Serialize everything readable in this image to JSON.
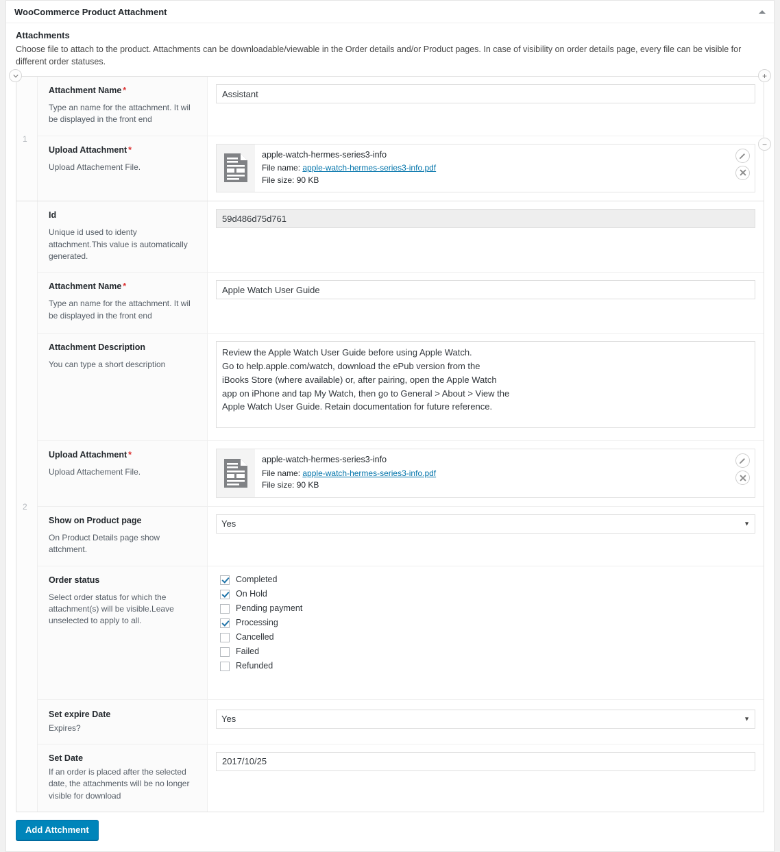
{
  "panel": {
    "title": "WooCommerce Product Attachment",
    "toggle_icon": "triangle-up-icon"
  },
  "intro": {
    "heading": "Attachments",
    "description": "Choose file to attach to the product. Attachments can be downloadable/viewable in the Order details and/or Product pages. In case of visibility on order details page, every file can be visible for different order statuses."
  },
  "repeater_controls": {
    "collapse_icon": "chevron-down-icon",
    "add_label": "+",
    "remove_label": "−"
  },
  "labels": {
    "attachment_name": "Attachment Name",
    "attachment_name_desc": "Type an name for the attachment. It wil be displayed in the front end",
    "upload_attachment": "Upload Attachment",
    "upload_attachment_desc": "Upload Attachement File.",
    "id": "Id",
    "id_desc": "Unique id used to identy attachment.This value is automatically generated.",
    "attachment_description": "Attachment Description",
    "attachment_description_desc": "You can type a short description",
    "show_on_product_page": "Show on Product page",
    "show_on_product_page_desc": "On Product Details page show attchment.",
    "order_status": "Order status",
    "order_status_desc": "Select order status for which the attachment(s) will be visible.Leave unselected to apply to all.",
    "set_expire_date": "Set expire Date",
    "set_expire_date_desc": "Expires?",
    "set_date": "Set Date",
    "set_date_desc": "If an order is placed after the selected date, the attachments will be no longer visible for download",
    "required_marker": "*"
  },
  "file_labels": {
    "file_name_prefix": "File name:",
    "file_size_prefix": "File size:",
    "edit_icon": "pencil-icon",
    "delete_icon": "close-x-icon"
  },
  "groups": [
    {
      "index": "1",
      "attachment_name": "Assistant",
      "file": {
        "title": "apple-watch-hermes-series3-info",
        "file_name": "apple-watch-hermes-series3-info.pdf",
        "file_size": "90 KB"
      }
    },
    {
      "index": "2",
      "id": "59d486d75d761",
      "attachment_name": "Apple Watch User Guide",
      "attachment_description": "Review the Apple Watch User Guide before using Apple Watch.\nGo to help.apple.com/watch, download the ePub version from the\niBooks Store (where available) or, after pairing, open the Apple Watch\napp on iPhone and tap My Watch, then go to General > About > View the\nApple Watch User Guide. Retain documentation for future reference.",
      "file": {
        "title": "apple-watch-hermes-series3-info",
        "file_name": "apple-watch-hermes-series3-info.pdf",
        "file_size": "90 KB"
      },
      "show_on_product_page": "Yes",
      "order_statuses": [
        {
          "label": "Completed",
          "checked": true
        },
        {
          "label": "On Hold",
          "checked": true
        },
        {
          "label": "Pending payment",
          "checked": false
        },
        {
          "label": "Processing",
          "checked": true
        },
        {
          "label": "Cancelled",
          "checked": false
        },
        {
          "label": "Failed",
          "checked": false
        },
        {
          "label": "Refunded",
          "checked": false
        }
      ],
      "set_expire_date": "Yes",
      "set_date": "2017/10/25"
    }
  ],
  "footer": {
    "add_attachment_label": "Add Attchment"
  },
  "colors": {
    "accent": "#0085ba",
    "link": "#0073aa",
    "required": "#dc3232",
    "checkbox_check": "#1e73a8"
  }
}
